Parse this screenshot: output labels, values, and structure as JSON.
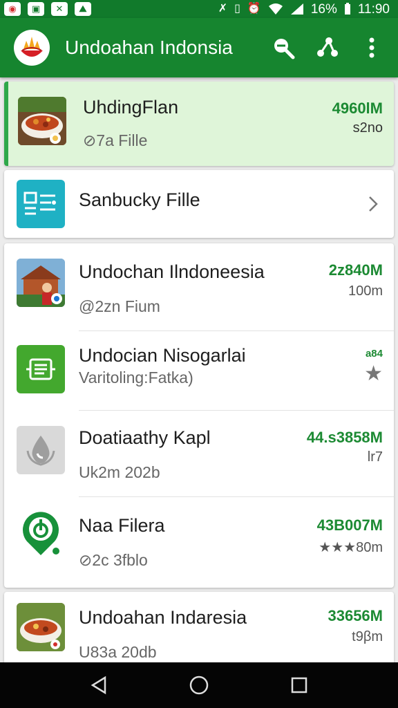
{
  "status_bar": {
    "battery": "16%",
    "time": "11:90"
  },
  "app_bar": {
    "title": "Undoahan Indonsia",
    "actions": [
      "search-icon",
      "share-icon",
      "more-vert-icon"
    ]
  },
  "featured": {
    "title": "UhdingFlan",
    "subtitle": "⊘7a Fille",
    "size": "4960lM",
    "meta": "s2no"
  },
  "secondary": {
    "title": "Sanbucky Fille"
  },
  "items": [
    {
      "title": "Undochan Ilndoneesia",
      "subtitle": "@2zn Fium",
      "size": "2z840M",
      "meta": "100m",
      "icon": "temple-photo"
    },
    {
      "title": "Undocian Nisogarlai",
      "subtitle": "Varitoling:Fatka)",
      "size": "a84",
      "meta": "★",
      "icon": "document-app-icon"
    },
    {
      "title": "Doatiaathy Kapl",
      "subtitle": "Uk2m 202b",
      "size": "44.s3858M",
      "meta": "lr7",
      "icon": "water-drop-icon"
    },
    {
      "title": "Naa Filera",
      "subtitle": "⊘2c 3fblo",
      "size": "43B007M",
      "meta": "★★★80m",
      "icon": "location-pin-icon"
    }
  ],
  "last_item": {
    "title": "Undoahan Indaresia",
    "subtitle": "U83a 20db",
    "size": "33656M",
    "meta": "t9βm"
  },
  "colors": {
    "app_bar": "#16852f",
    "status_bar": "#117a2b",
    "accent_green": "#1c8a33",
    "featured_bg": "#dff5d9"
  }
}
